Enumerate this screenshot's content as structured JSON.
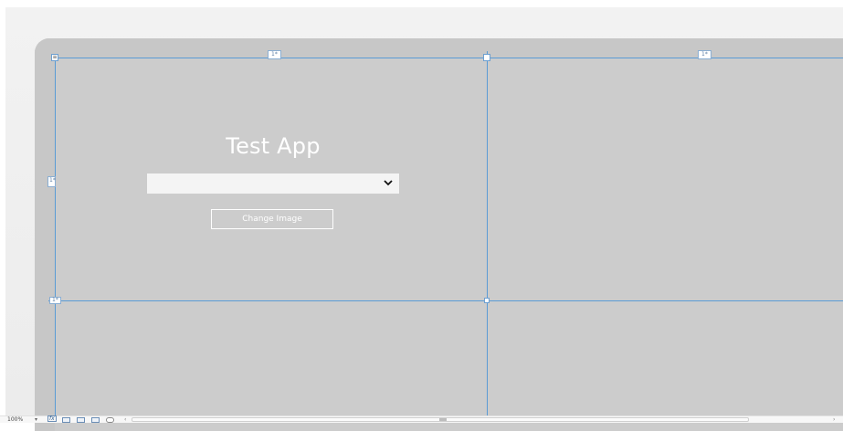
{
  "app": {
    "title": "Test App",
    "combo_value": "",
    "change_image_label": "Change Image"
  },
  "designer": {
    "column_marker_left": "1*",
    "column_marker_right": "1*",
    "row_marker_top": "1*",
    "row_marker_bottom": "1*",
    "corner_marker": "≡"
  },
  "status_bar": {
    "zoom": "100%",
    "zoom_dropdown_icon": "chevron-down-icon",
    "fx_label": "fx",
    "icons": [
      "effects-icon",
      "grid-icon",
      "snap-grid-icon",
      "snap-lines-icon",
      "annotation-icon"
    ],
    "scroll_left": "‹",
    "scroll_right": "›"
  },
  "colors": {
    "device_surface": "#cccccc",
    "gridline": "#5a9bd5",
    "text_white": "#ffffff"
  }
}
